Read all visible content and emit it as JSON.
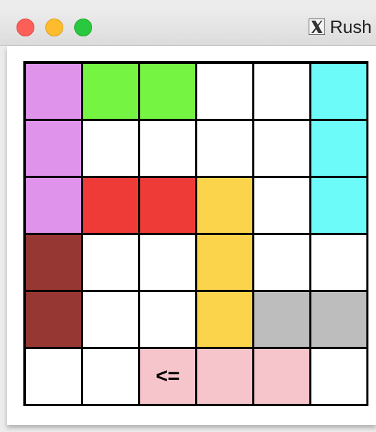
{
  "window": {
    "title": "Rush",
    "icon": "x11-icon"
  },
  "colors": {
    "purple": "#df93eb",
    "green": "#76f442",
    "cyan": "#6dfbfa",
    "red": "#ef3b37",
    "yellow": "#fbd44c",
    "brown": "#973733",
    "gray": "#bdbdbd",
    "pink": "#f6c4cb",
    "empty": "#ffffff"
  },
  "board": {
    "rows": 6,
    "cols": 6,
    "cells": [
      [
        "purple",
        "green",
        "green",
        "empty",
        "empty",
        "cyan"
      ],
      [
        "purple",
        "empty",
        "empty",
        "empty",
        "empty",
        "cyan"
      ],
      [
        "purple",
        "red",
        "red",
        "yellow",
        "empty",
        "cyan"
      ],
      [
        "brown",
        "empty",
        "empty",
        "yellow",
        "empty",
        "empty"
      ],
      [
        "brown",
        "empty",
        "empty",
        "yellow",
        "gray",
        "gray"
      ],
      [
        "empty",
        "empty",
        "pink",
        "pink",
        "pink",
        "empty"
      ]
    ],
    "labels": [
      {
        "row": 5,
        "col": 2,
        "text": "<="
      }
    ]
  }
}
